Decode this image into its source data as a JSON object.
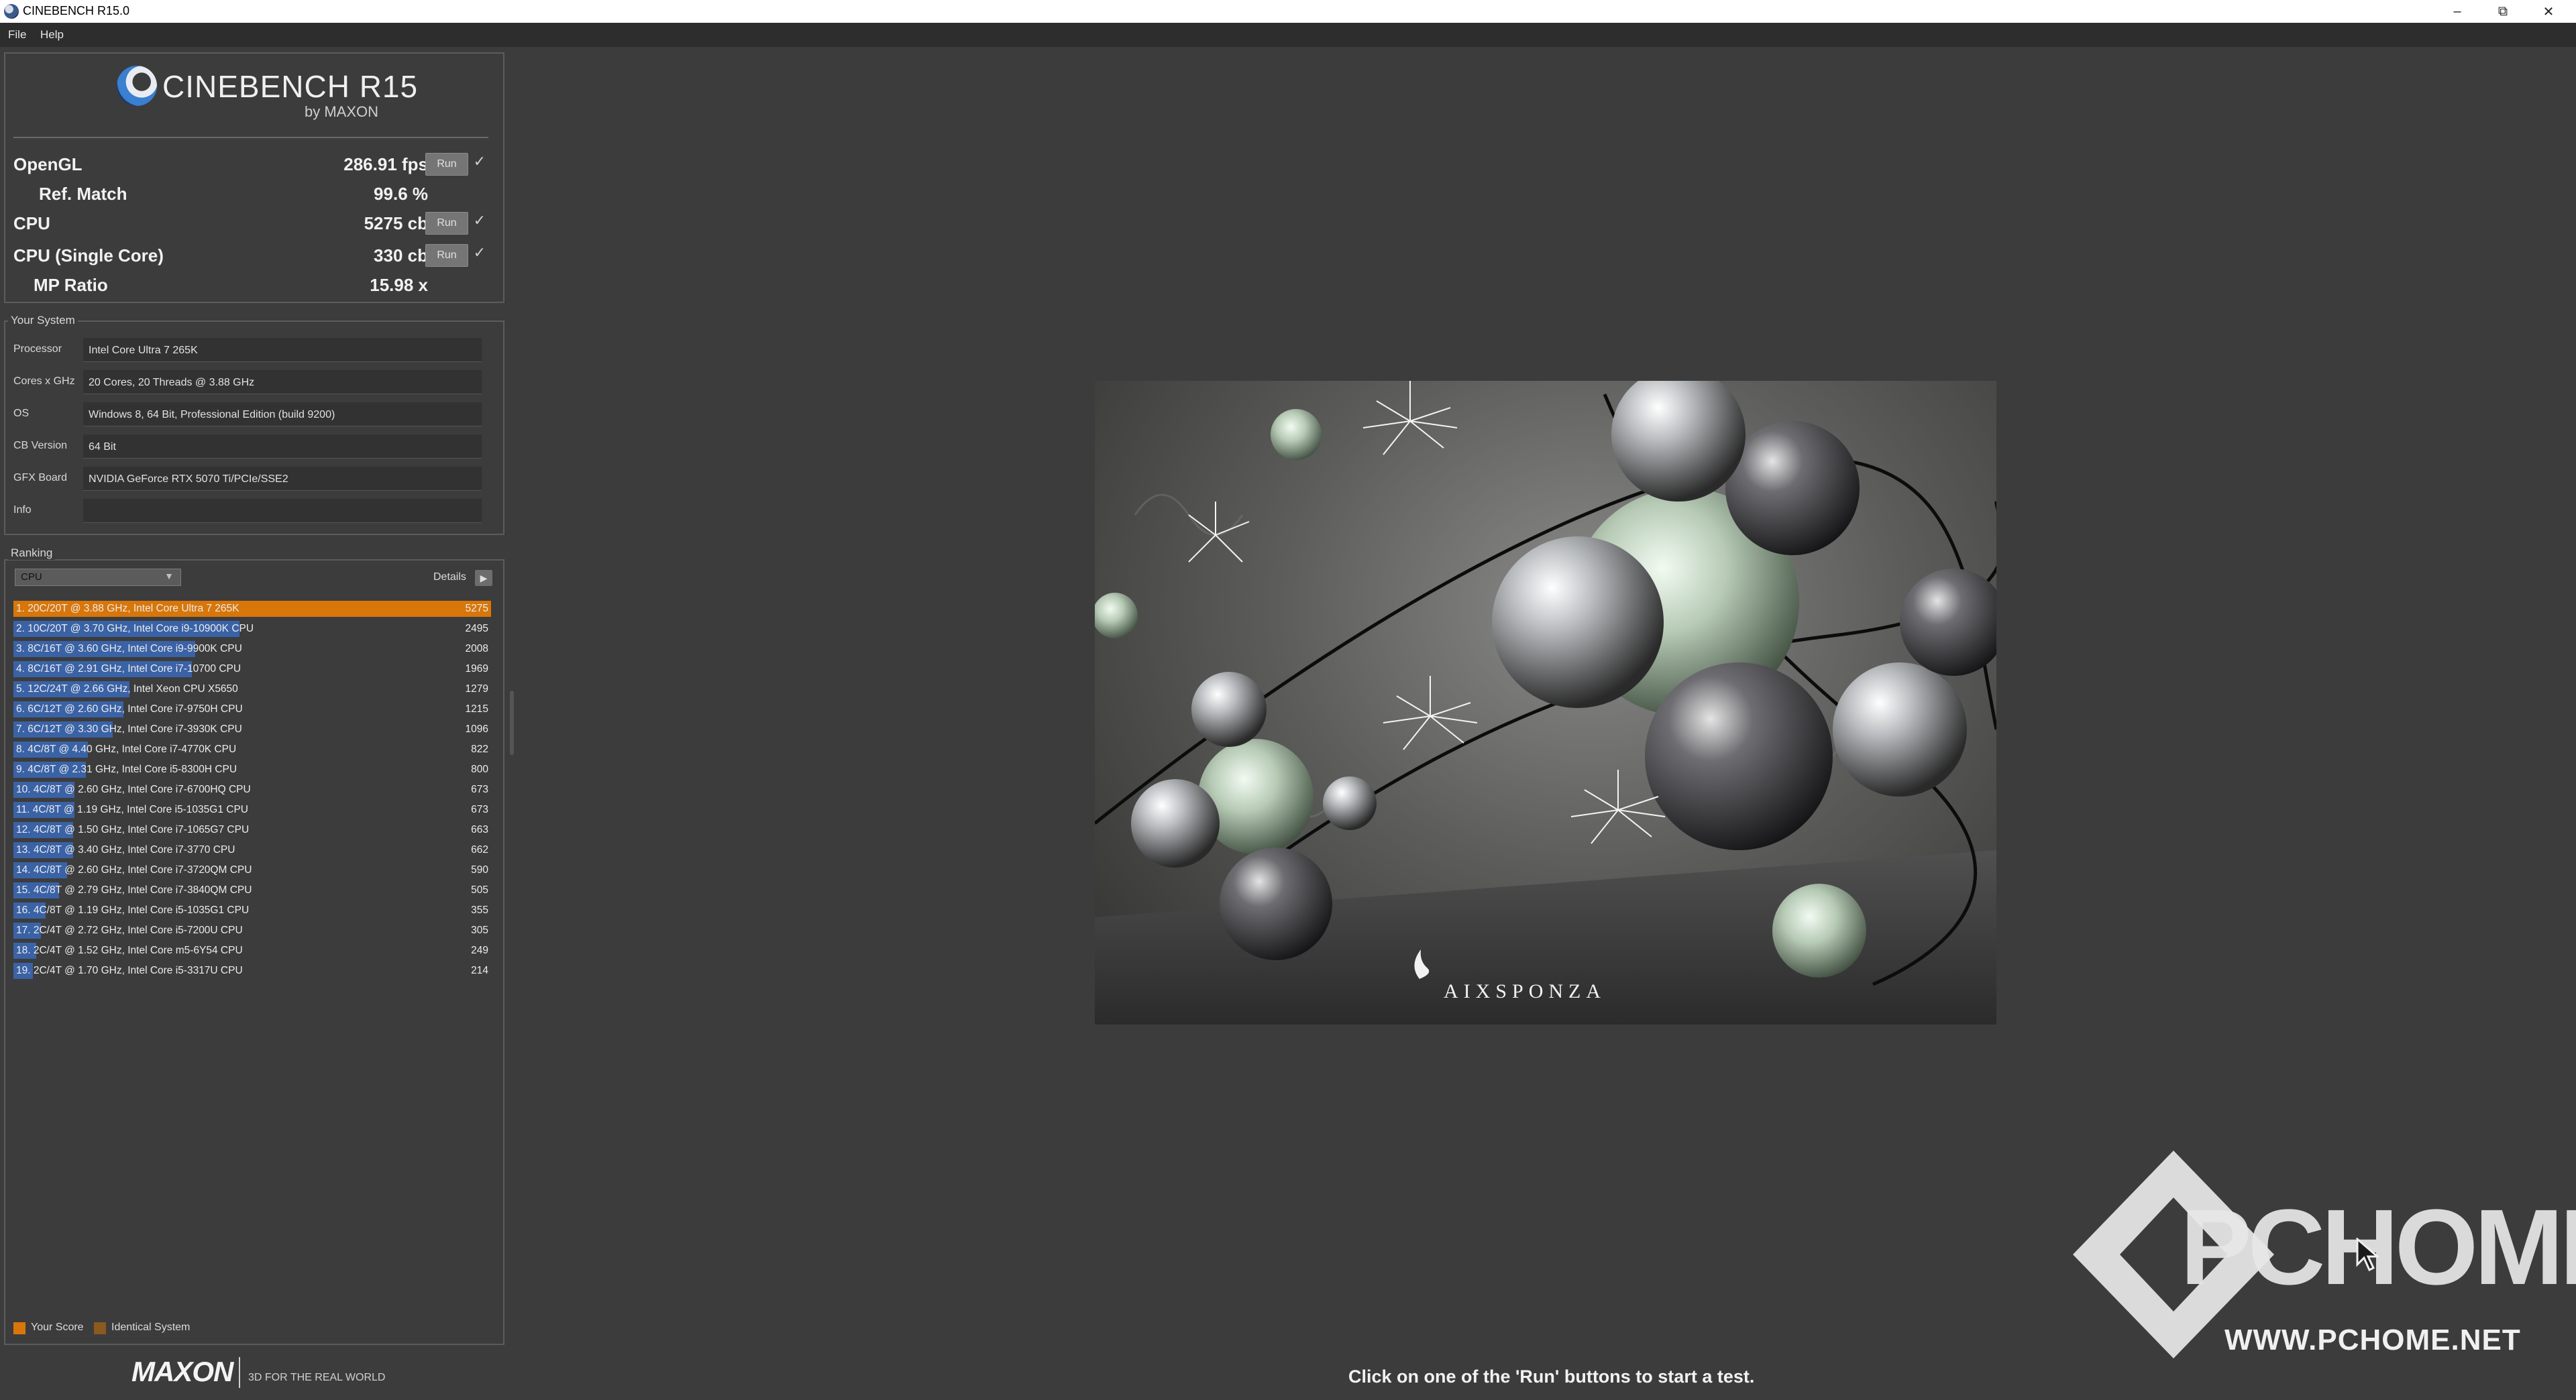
{
  "window": {
    "title": "CINEBENCH R15.0",
    "controls": [
      "minimize-icon",
      "restore-icon",
      "close-icon"
    ]
  },
  "menu": [
    "File",
    "Help"
  ],
  "logo": {
    "title": "CINEBENCH R15",
    "byline": "by MAXON"
  },
  "scores": [
    {
      "label": "OpenGL",
      "value": "286.91 fps",
      "run": "Run",
      "checked": true
    },
    {
      "label": "Ref. Match",
      "value": "99.6 %"
    },
    {
      "label": "CPU",
      "value": "5275 cb",
      "run": "Run",
      "checked": true
    },
    {
      "label": "CPU (Single Core)",
      "value": "330 cb",
      "run": "Run",
      "checked": true
    },
    {
      "label": "MP Ratio",
      "value": "15.98 x"
    }
  ],
  "your_system": {
    "title": "Your System",
    "rows": [
      {
        "label": "Processor",
        "value": "Intel Core Ultra 7 265K"
      },
      {
        "label": "Cores x GHz",
        "value": "20 Cores, 20 Threads @ 3.88 GHz"
      },
      {
        "label": "OS",
        "value": "Windows 8, 64 Bit, Professional Edition (build 9200)"
      },
      {
        "label": "CB Version",
        "value": "64 Bit"
      },
      {
        "label": "GFX Board",
        "value": "NVIDIA GeForce RTX 5070 Ti/PCIe/SSE2"
      },
      {
        "label": "Info",
        "value": ""
      }
    ]
  },
  "ranking": {
    "title": "Ranking",
    "dropdown": "CPU",
    "details": "Details",
    "items": [
      {
        "label": "1. 20C/20T @ 3.88 GHz, Intel Core Ultra 7 265K",
        "score": "5275"
      },
      {
        "label": "2. 10C/20T @ 3.70 GHz, Intel Core i9-10900K CPU",
        "score": "2495"
      },
      {
        "label": "3. 8C/16T @ 3.60 GHz, Intel Core i9-9900K CPU",
        "score": "2008"
      },
      {
        "label": "4. 8C/16T @ 2.91 GHz, Intel Core i7-10700 CPU",
        "score": "1969"
      },
      {
        "label": "5. 12C/24T @ 2.66 GHz, Intel Xeon CPU X5650",
        "score": "1279"
      },
      {
        "label": "6. 6C/12T @ 2.60 GHz, Intel Core i7-9750H CPU",
        "score": "1215"
      },
      {
        "label": "7. 6C/12T @ 3.30 GHz,  Intel Core i7-3930K CPU",
        "score": "1096"
      },
      {
        "label": "8. 4C/8T @ 4.40 GHz, Intel Core i7-4770K CPU",
        "score": "822"
      },
      {
        "label": "9. 4C/8T @ 2.31 GHz, Intel Core i5-8300H CPU",
        "score": "800"
      },
      {
        "label": "10. 4C/8T @ 2.60 GHz, Intel Core i7-6700HQ CPU",
        "score": "673"
      },
      {
        "label": "11. 4C/8T @ 1.19 GHz, Intel Core i5-1035G1 CPU",
        "score": "673"
      },
      {
        "label": "12. 4C/8T @ 1.50 GHz, Intel Core i7-1065G7 CPU",
        "score": "663"
      },
      {
        "label": "13. 4C/8T @ 3.40 GHz,  Intel Core i7-3770 CPU",
        "score": "662"
      },
      {
        "label": "14. 4C/8T @ 2.60 GHz, Intel Core i7-3720QM CPU",
        "score": "590"
      },
      {
        "label": "15. 4C/8T @ 2.79 GHz,  Intel Core i7-3840QM CPU",
        "score": "505"
      },
      {
        "label": "16. 4C/8T @ 1.19 GHz, Intel Core i5-1035G1 CPU",
        "score": "355"
      },
      {
        "label": "17. 2C/4T @ 2.72 GHz, Intel Core i5-7200U CPU",
        "score": "305"
      },
      {
        "label": "18. 2C/4T @ 1.52 GHz, Intel Core m5-6Y54 CPU",
        "score": "249"
      },
      {
        "label": "19. 2C/4T @ 1.70 GHz,  Intel Core i5-3317U CPU",
        "score": "214"
      }
    ]
  },
  "legend": [
    {
      "label": "Your Score",
      "color": "#d8760a"
    },
    {
      "label": "Identical System",
      "color": "#8a5a1e"
    }
  ],
  "footer": {
    "brand": "MAXON",
    "tagline": "3D FOR THE REAL WORLD"
  },
  "render": {
    "signature": "AIXSPONZA"
  },
  "status": "Click on one of the 'Run' buttons to start a test.",
  "watermark": {
    "text": "PCHOME",
    "url": "WWW.PCHOME.NET"
  },
  "colors": {
    "background": "#3c3c3c",
    "your_score": "#d8760a",
    "rank_bar": "#3a62a6"
  }
}
